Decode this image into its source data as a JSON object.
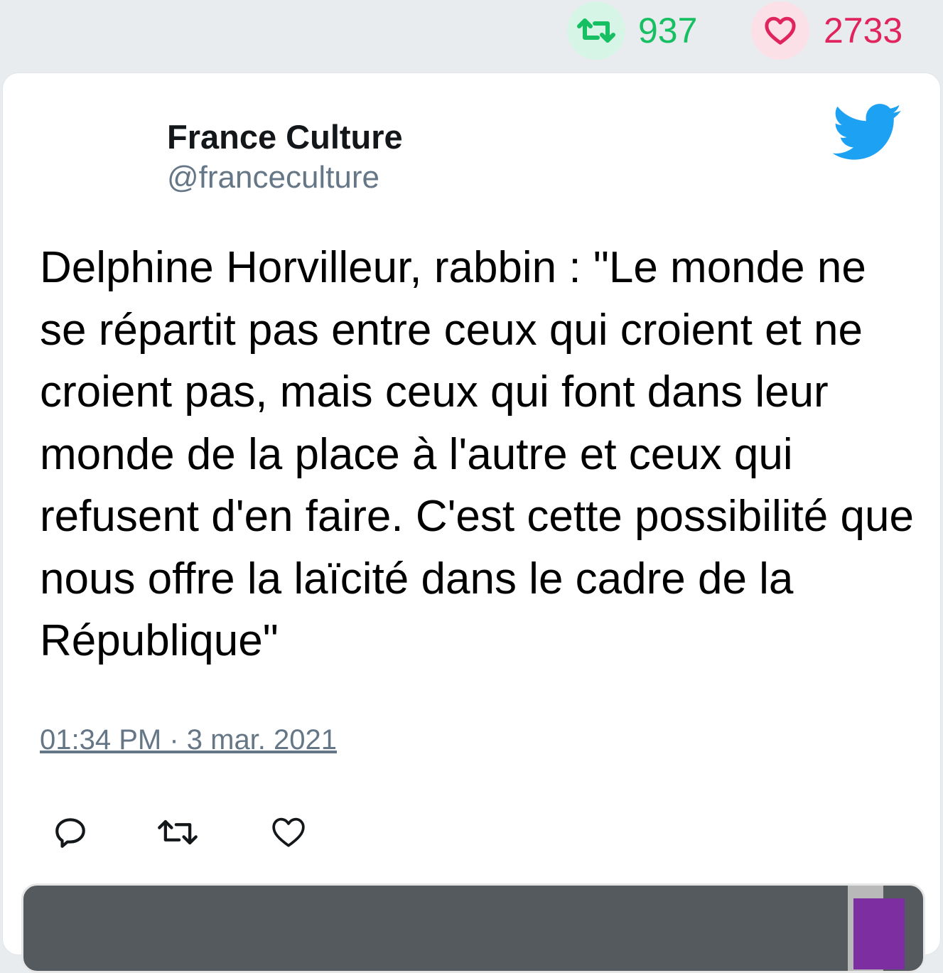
{
  "stats": {
    "retweets": "937",
    "likes": "2733"
  },
  "colors": {
    "retweet_green": "#17bf63",
    "like_red": "#e0245e",
    "twitter_blue": "#1da1f2",
    "handle_gray": "#657786"
  },
  "icons": {
    "retweet": "retweet-icon",
    "like": "heart-icon",
    "logo": "twitter-bird-icon",
    "reply": "reply-icon"
  },
  "tweet": {
    "author_name": "France Culture",
    "author_handle": "@franceculture",
    "text": "Delphine Horvilleur, rabbin : \"Le monde ne se répartit pas entre ceux qui croient et ne croient pas, mais ceux qui font dans leur monde de la place à l'autre et ceux qui refusent d'en faire. C'est cette possibilité que nous offre la laïcité dans le cadre de la République\"",
    "timestamp": "01:34 PM · 3 mar. 2021"
  }
}
